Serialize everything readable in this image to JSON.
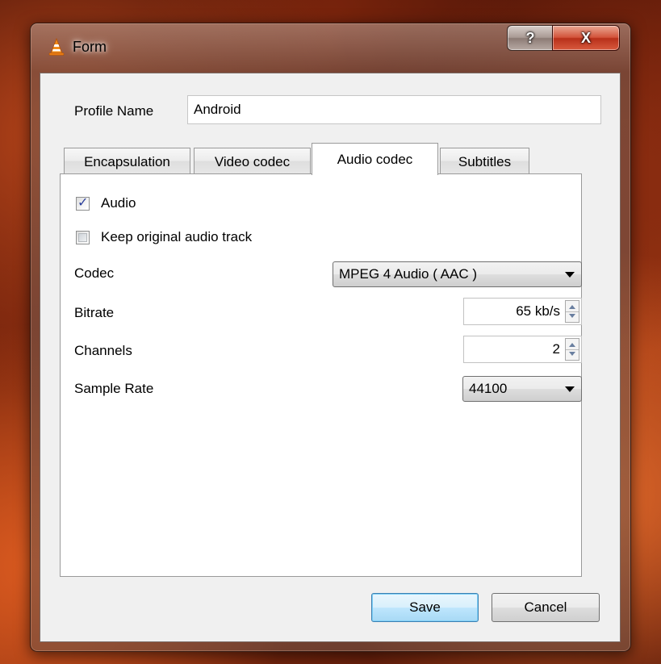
{
  "window": {
    "title": "Form",
    "help_glyph": "?",
    "close_glyph": "X"
  },
  "profile": {
    "label": "Profile Name",
    "value": "Android"
  },
  "tabs": [
    {
      "label": "Encapsulation",
      "active": false
    },
    {
      "label": "Video codec",
      "active": false
    },
    {
      "label": "Audio codec",
      "active": true
    },
    {
      "label": "Subtitles",
      "active": false
    }
  ],
  "audio": {
    "audio_checkbox": {
      "label": "Audio",
      "checked": true
    },
    "keep_track_checkbox": {
      "label": "Keep original audio track",
      "checked": false
    },
    "codec": {
      "label": "Codec",
      "value": "MPEG 4 Audio ( AAC )"
    },
    "bitrate": {
      "label": "Bitrate",
      "value": "65 kb/s"
    },
    "channels": {
      "label": "Channels",
      "value": "2"
    },
    "sample_rate": {
      "label": "Sample Rate",
      "value": "44100"
    }
  },
  "buttons": {
    "save": "Save",
    "cancel": "Cancel"
  },
  "colors": {
    "window_bg": "#f0f0f0",
    "default_button_border": "#3c7fb1",
    "close_button": "#c8402a"
  },
  "icons": {
    "app": "vlc-cone-icon",
    "help": "help-icon",
    "close": "close-icon",
    "check": "checkmark-icon",
    "dropdown": "chevron-down-icon",
    "spin": "spin-arrows-icon"
  }
}
